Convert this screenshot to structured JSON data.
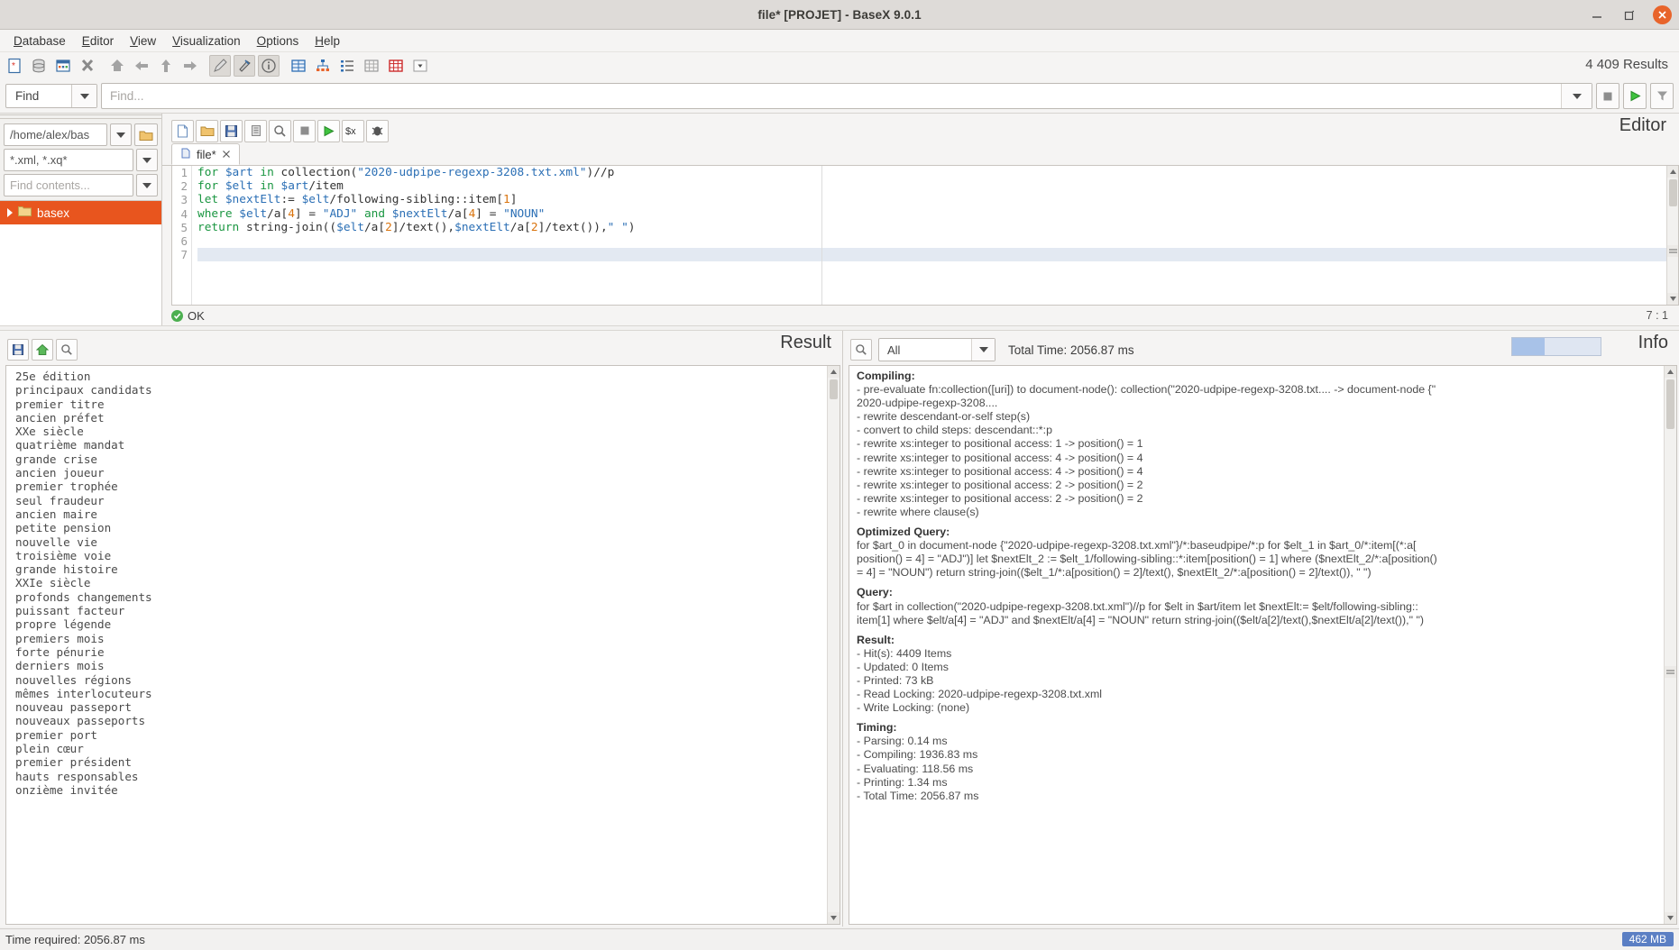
{
  "window": {
    "title": "file* [PROJET] - BaseX 9.0.1",
    "minimize_label": "minimize",
    "maximize_label": "maximize",
    "close_label": "close"
  },
  "menubar": {
    "items": [
      {
        "label": "Database",
        "mnemonic": "D"
      },
      {
        "label": "Editor",
        "mnemonic": "E"
      },
      {
        "label": "View",
        "mnemonic": "V"
      },
      {
        "label": "Visualization",
        "mnemonic": "V"
      },
      {
        "label": "Options",
        "mnemonic": "O"
      },
      {
        "label": "Help",
        "mnemonic": "H"
      }
    ]
  },
  "toolbar": {
    "results_count": "4 409 Results",
    "buttons": [
      {
        "name": "new-document-icon"
      },
      {
        "name": "database-icon"
      },
      {
        "name": "open-database-icon"
      },
      {
        "name": "close-database-icon"
      },
      {
        "name": "home-icon"
      },
      {
        "name": "go-back-icon"
      },
      {
        "name": "go-up-icon"
      },
      {
        "name": "go-forward-icon"
      },
      {
        "name": "edit-icon"
      },
      {
        "name": "filter-nodes-icon"
      },
      {
        "name": "info-icon"
      },
      {
        "name": "table-view-icon"
      },
      {
        "name": "tree-view-icon"
      },
      {
        "name": "folder-view-icon"
      },
      {
        "name": "map-view-icon"
      },
      {
        "name": "plot-view-icon"
      },
      {
        "name": "more-views-icon"
      }
    ]
  },
  "findbar": {
    "mode_value": "Find",
    "input_placeholder": "Find...",
    "stop_label": "stop",
    "run_label": "run",
    "filter_label": "filter"
  },
  "project": {
    "path_value": "/home/alex/bas",
    "filter_value": "*.xml, *.xq*",
    "contents_placeholder": "Find contents...",
    "tree": [
      {
        "label": "basex",
        "selected": true
      }
    ]
  },
  "editor": {
    "panel_title": "Editor",
    "tab": {
      "label": "file*",
      "close_label": "x"
    },
    "status_text": "OK",
    "caret_position": "7 : 1",
    "buttons": [
      {
        "name": "new-file-icon"
      },
      {
        "name": "open-file-icon"
      },
      {
        "name": "save-file-icon"
      },
      {
        "name": "history-icon"
      },
      {
        "name": "search-icon"
      },
      {
        "name": "stop-icon"
      },
      {
        "name": "run-query-icon"
      },
      {
        "name": "external-variables-icon"
      },
      {
        "name": "debug-icon"
      }
    ],
    "code_lines": [
      {
        "n": "1",
        "tokens": [
          {
            "t": "for ",
            "c": "k"
          },
          {
            "t": "$art",
            "c": "v"
          },
          {
            "t": " ",
            "c": "p"
          },
          {
            "t": "in ",
            "c": "k"
          },
          {
            "t": "collection(",
            "c": "p"
          },
          {
            "t": "\"2020-udpipe-regexp-3208.txt.xml\"",
            "c": "s"
          },
          {
            "t": ")//p",
            "c": "p"
          }
        ]
      },
      {
        "n": "2",
        "tokens": [
          {
            "t": "for ",
            "c": "k"
          },
          {
            "t": "$elt",
            "c": "v"
          },
          {
            "t": " ",
            "c": "p"
          },
          {
            "t": "in ",
            "c": "k"
          },
          {
            "t": "$art",
            "c": "v"
          },
          {
            "t": "/item",
            "c": "p"
          }
        ]
      },
      {
        "n": "3",
        "tokens": [
          {
            "t": "let ",
            "c": "k"
          },
          {
            "t": "$nextElt",
            "c": "v"
          },
          {
            "t": ":= ",
            "c": "p"
          },
          {
            "t": "$elt",
            "c": "v"
          },
          {
            "t": "/following-sibling::item[",
            "c": "p"
          },
          {
            "t": "1",
            "c": "n"
          },
          {
            "t": "]",
            "c": "p"
          }
        ]
      },
      {
        "n": "4",
        "tokens": [
          {
            "t": "where ",
            "c": "k"
          },
          {
            "t": "$elt",
            "c": "v"
          },
          {
            "t": "/a[",
            "c": "p"
          },
          {
            "t": "4",
            "c": "n"
          },
          {
            "t": "] = ",
            "c": "p"
          },
          {
            "t": "\"ADJ\"",
            "c": "s"
          },
          {
            "t": " and ",
            "c": "k"
          },
          {
            "t": "$nextElt",
            "c": "v"
          },
          {
            "t": "/a[",
            "c": "p"
          },
          {
            "t": "4",
            "c": "n"
          },
          {
            "t": "] = ",
            "c": "p"
          },
          {
            "t": "\"NOUN\"",
            "c": "s"
          }
        ]
      },
      {
        "n": "5",
        "tokens": [
          {
            "t": "return ",
            "c": "k"
          },
          {
            "t": "string-join((",
            "c": "p"
          },
          {
            "t": "$elt",
            "c": "v"
          },
          {
            "t": "/a[",
            "c": "p"
          },
          {
            "t": "2",
            "c": "n"
          },
          {
            "t": "]/text(),",
            "c": "p"
          },
          {
            "t": "$nextElt",
            "c": "v"
          },
          {
            "t": "/a[",
            "c": "p"
          },
          {
            "t": "2",
            "c": "n"
          },
          {
            "t": "]/text()),",
            "c": "p"
          },
          {
            "t": "\" \"",
            "c": "s"
          },
          {
            "t": ")",
            "c": "p"
          }
        ]
      },
      {
        "n": "6",
        "tokens": []
      },
      {
        "n": "7",
        "tokens": [],
        "current": true
      }
    ]
  },
  "result": {
    "panel_title": "Result",
    "buttons": [
      {
        "name": "save-result-icon"
      },
      {
        "name": "home-icon"
      },
      {
        "name": "search-icon"
      }
    ],
    "lines": [
      "25e édition",
      "principaux candidats",
      "premier titre",
      "ancien préfet",
      "XXe siècle",
      "quatrième mandat",
      "grande crise",
      "ancien joueur",
      "premier trophée",
      "seul fraudeur",
      "ancien maire",
      "petite pension",
      "nouvelle vie",
      "troisième voie",
      "grande histoire",
      "XXIe siècle",
      "profonds changements",
      "puissant facteur",
      "propre légende",
      "premiers mois",
      "forte pénurie",
      "derniers mois",
      "nouvelles régions",
      "mêmes interlocuteurs",
      "nouveau passeport",
      "nouveaux passeports",
      "premier port",
      "plein cœur",
      "premier président",
      "hauts responsables",
      "onzième invitée"
    ]
  },
  "info": {
    "panel_title": "Info",
    "search_icon_label": "search",
    "filter_value": "All",
    "total_time": "Total Time: 2056.87 ms",
    "sections": [
      {
        "heading": "Compiling:",
        "lines": [
          "- pre-evaluate fn:collection([uri]) to document-node(): collection(\"2020-udpipe-regexp-3208.txt.... -> document-node {\"",
          "2020-udpipe-regexp-3208....",
          "- rewrite descendant-or-self step(s)",
          "- convert to child steps: descendant::*:p",
          "- rewrite xs:integer to positional access: 1 -> position() = 1",
          "- rewrite xs:integer to positional access: 4 -> position() = 4",
          "- rewrite xs:integer to positional access: 4 -> position() = 4",
          "- rewrite xs:integer to positional access: 2 -> position() = 2",
          "- rewrite xs:integer to positional access: 2 -> position() = 2",
          "- rewrite where clause(s)"
        ]
      },
      {
        "heading": "Optimized Query:",
        "lines": [
          "for $art_0 in document-node {\"2020-udpipe-regexp-3208.txt.xml\"}/*:baseudpipe/*:p for $elt_1 in $art_0/*:item[(*:a[",
          "position() = 4] = \"ADJ\")] let $nextElt_2 := $elt_1/following-sibling::*:item[position() = 1] where ($nextElt_2/*:a[position()",
          " = 4] = \"NOUN\") return string-join(($elt_1/*:a[position() = 2]/text(), $nextElt_2/*:a[position() = 2]/text()), \" \")"
        ]
      },
      {
        "heading": "Query:",
        "lines": [
          "for $art in collection(\"2020-udpipe-regexp-3208.txt.xml\")//p for $elt in $art/item let $nextElt:= $elt/following-sibling::",
          "item[1] where $elt/a[4] = \"ADJ\" and $nextElt/a[4] = \"NOUN\" return string-join(($elt/a[2]/text(),$nextElt/a[2]/text()),\" \")"
        ]
      },
      {
        "heading": "Result:",
        "lines": [
          "- Hit(s): 4409 Items",
          "- Updated: 0 Items",
          "- Printed: 73 kB",
          "- Read Locking: 2020-udpipe-regexp-3208.txt.xml",
          "- Write Locking: (none)"
        ]
      },
      {
        "heading": "Timing:",
        "lines": [
          "- Parsing: 0.14 ms",
          "- Compiling: 1936.83 ms",
          "- Evaluating: 118.56 ms",
          "- Printing: 1.34 ms",
          "- Total Time: 2056.87 ms"
        ]
      }
    ]
  },
  "statusbar": {
    "text": "Time required: 2056.87 ms",
    "memory": "462 MB"
  },
  "colors": {
    "accent_orange": "#e8551e",
    "close_button": "#e8642b",
    "keyword_green": "#1a9641",
    "string_blue": "#2b6fb5",
    "number_orange": "#d9730d",
    "memory_chip": "#5b7fc4"
  }
}
